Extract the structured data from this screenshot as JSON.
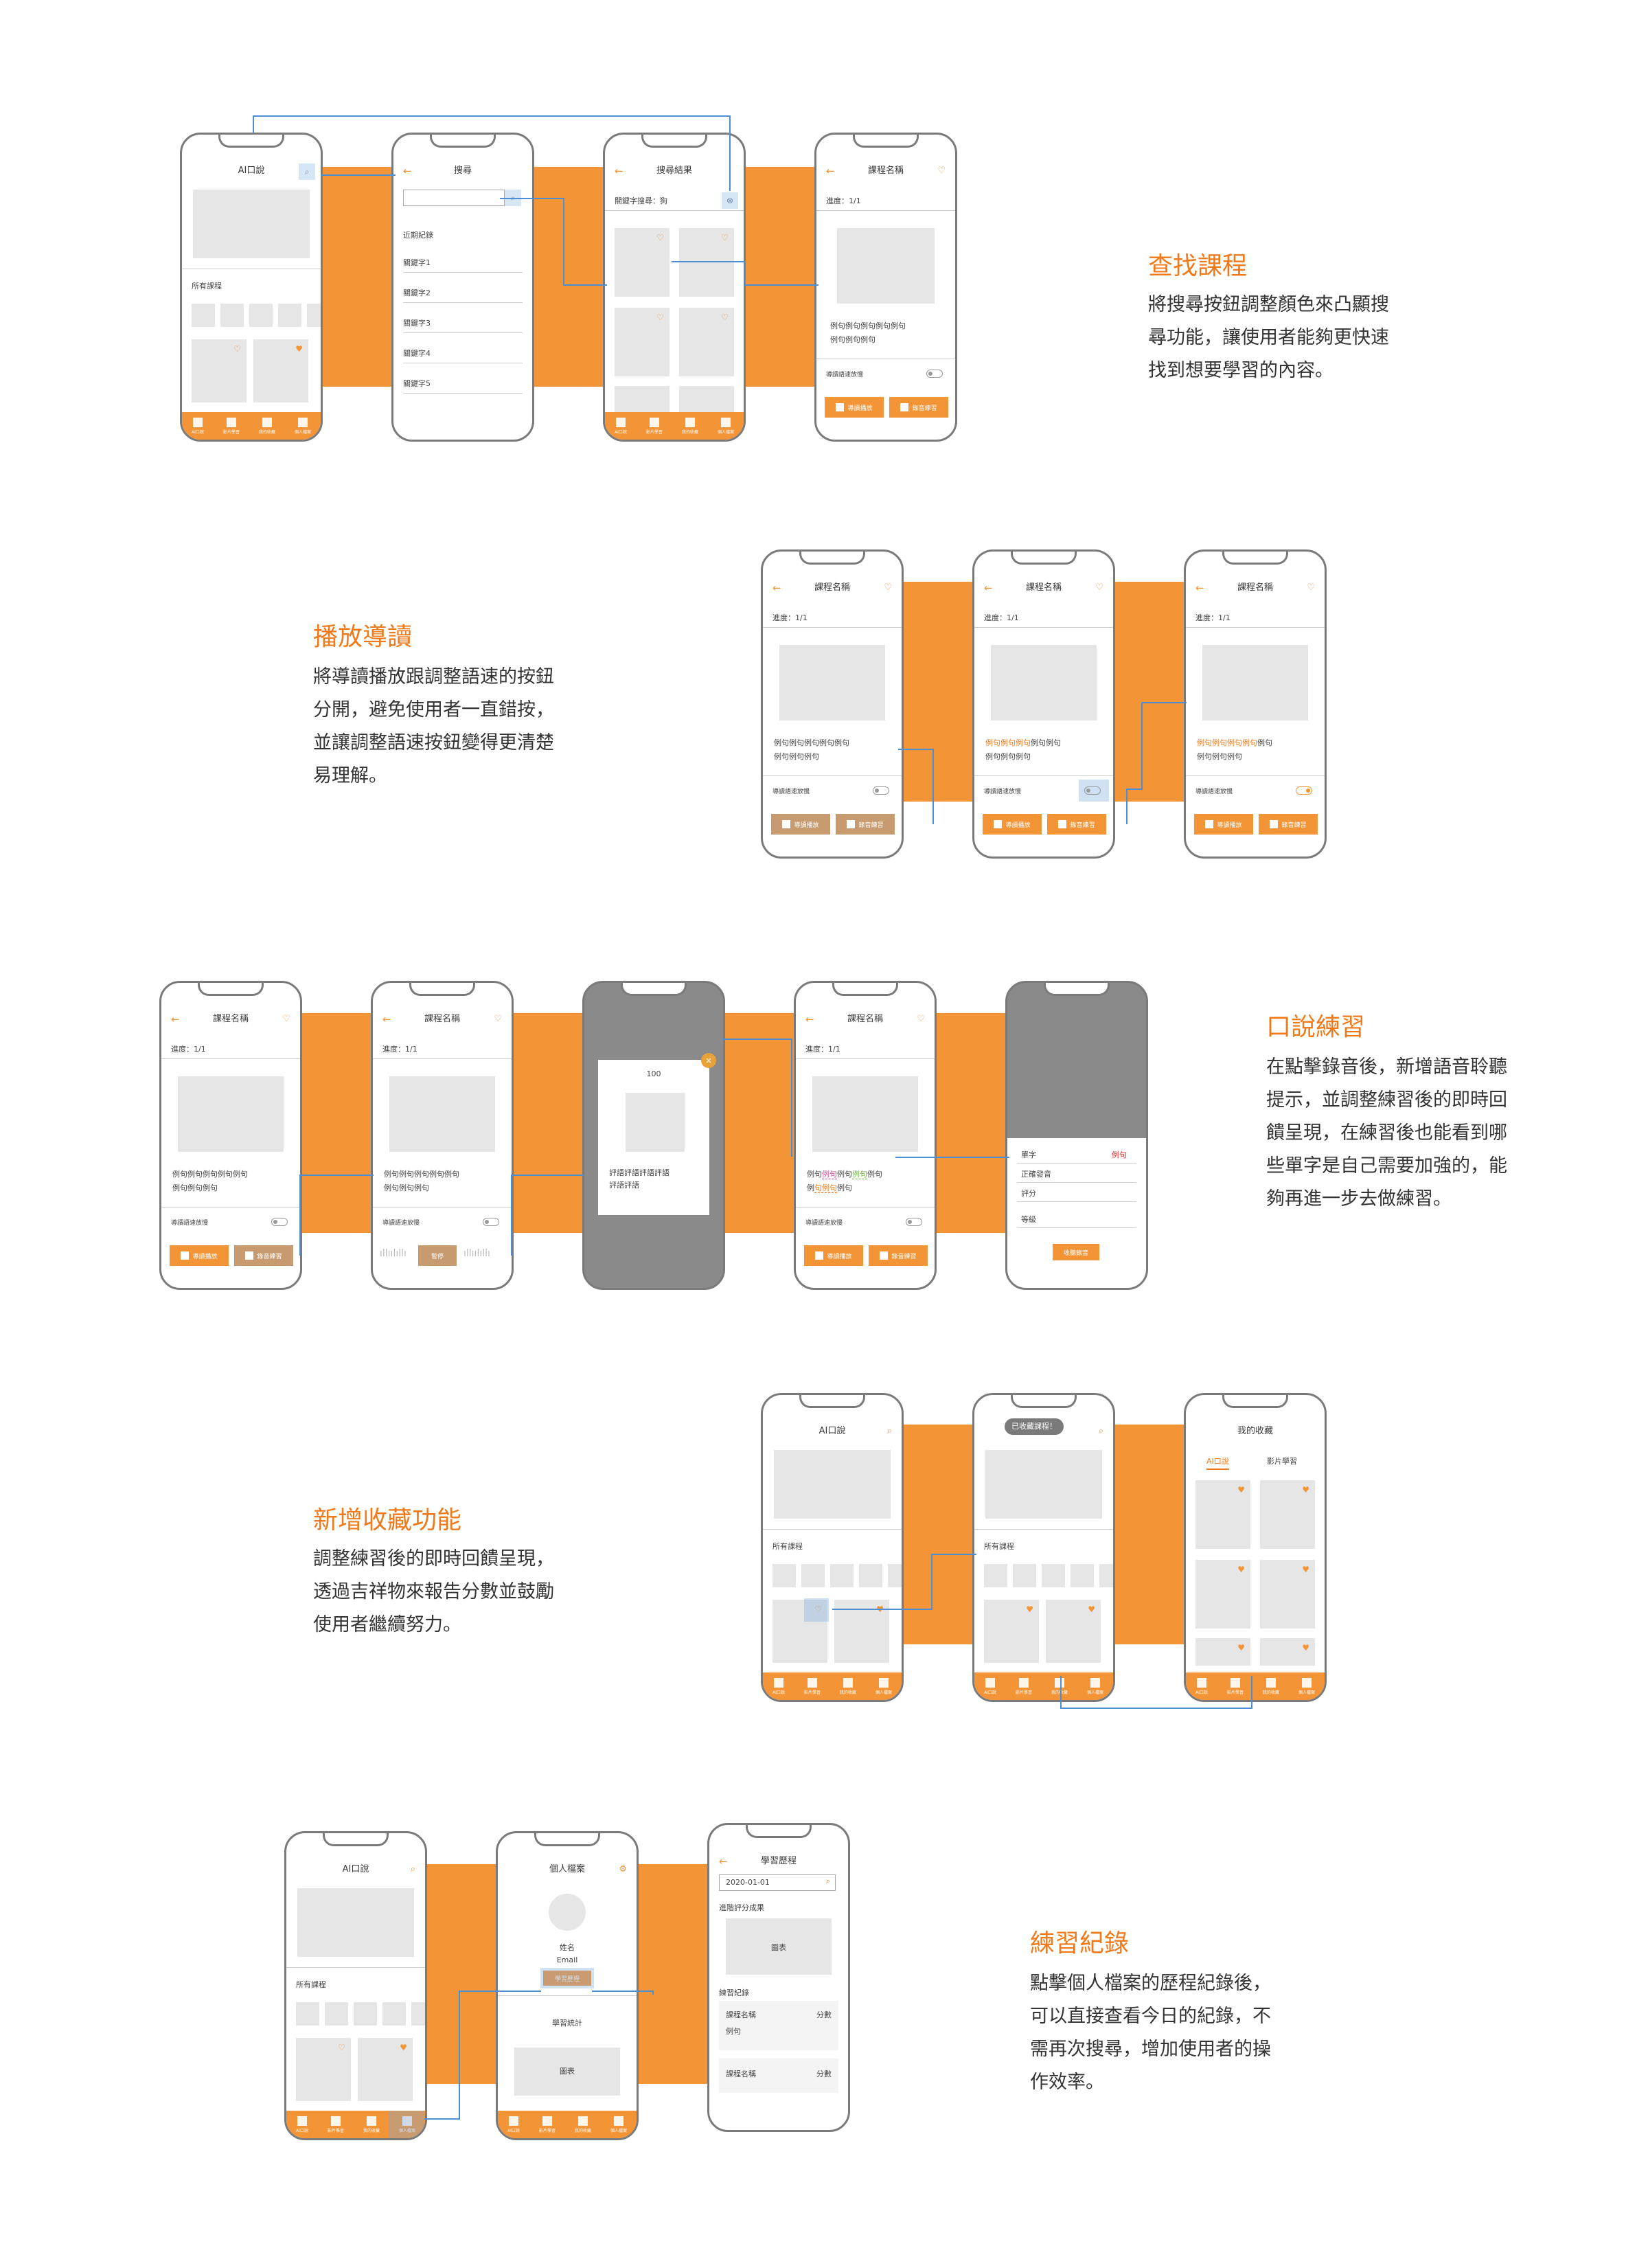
{
  "sections": [
    {
      "title": "查找課程",
      "desc": [
        "將搜尋按鈕調整顏色來凸顯搜",
        "尋功能，讓使用者能夠更快速",
        "找到想要學習的內容。"
      ]
    },
    {
      "title": "播放導讀",
      "desc": [
        "將導讀播放跟調整語速的按鈕",
        "分開，避免使用者一直錯按，",
        "並讓調整語速按鈕變得更清楚",
        "易理解。"
      ]
    },
    {
      "title": "口說練習",
      "desc": [
        "在點擊錄音後，新增語音聆聽",
        "提示，並調整練習後的即時回",
        "饋呈現，在練習後也能看到哪",
        "些單字是自己需要加強的，能",
        "夠再進一步去做練習。"
      ]
    },
    {
      "title": "新增收藏功能",
      "desc": [
        "調整練習後的即時回饋呈現，",
        "透過吉祥物來報告分數並鼓勵",
        "使用者繼續努力。"
      ]
    },
    {
      "title": "練習紀錄",
      "desc": [
        "點擊個人檔案的歷程紀錄後，",
        "可以直接查看今日的紀錄，不",
        "需再次搜尋，增加使用者的操",
        "作效率。"
      ]
    }
  ],
  "tabs": [
    "AI口說",
    "影片學習",
    "我的收藏",
    "個人檔案"
  ],
  "ui": {
    "home_title": "AI口說",
    "all_courses": "所有課程",
    "search_title": "搜尋",
    "recent": "近期紀錄",
    "keywords": [
      "關鍵字1",
      "關鍵字2",
      "關鍵字3",
      "關鍵字4",
      "關鍵字5"
    ],
    "results_title": "搜尋結果",
    "results_query": "關鍵字搜尋：狗",
    "course_title": "課程名稱",
    "progress": "進度：1/1",
    "sentence1": "例句例句例句例句例句",
    "sentence2": "例句例句例句",
    "speed_label": "導讀語速放慢",
    "btn_play": "導讀播放",
    "btn_record": "錄音練習",
    "btn_pause": "暫停",
    "score": "100",
    "comment1": "評語評語評語評語",
    "comment2": "評語評語",
    "word_table": {
      "word": "單字",
      "example": "例句",
      "pron": "正確發音",
      "rating": "評分",
      "level": "等級",
      "btn": "收聽錄音"
    },
    "toast": "已收藏課程！",
    "fav_title": "我的收藏",
    "fav_tab1": "AI口說",
    "fav_tab2": "影片學習",
    "profile_title": "個人檔案",
    "name": "姓名",
    "email": "Email",
    "history_btn": "學習歷程",
    "stats": "學習統計",
    "chart": "圖表",
    "history_title": "學習歷程",
    "date": "2020-01-01",
    "adv": "進階評分成果",
    "practice_log": "練習紀錄",
    "score_lbl": "分數",
    "example": "例句"
  },
  "colors": {
    "accent": "#f39436",
    "highlight": "#d7e6f4",
    "link": "#4a8fd6"
  }
}
